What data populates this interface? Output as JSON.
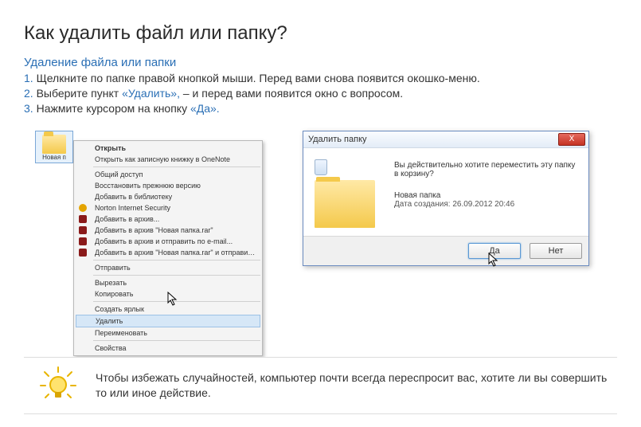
{
  "title": "Как удалить файл или папку?",
  "subtitle": "Удаление файла или папки",
  "steps": {
    "s1_num": "1.",
    "s1_a": "Щелкните по папке правой кнопкой мыши. Перед вами снова появится окошко-меню.",
    "s2_num": "2.",
    "s2_a": "Выберите пункт ",
    "s2_kw": "«Удалить»,",
    "s2_b": " – и перед вами появится окно с вопросом.",
    "s3_num": "3.",
    "s3_a": "Нажмите курсором на кнопку ",
    "s3_kw": "«Да»."
  },
  "folder_label": "Новая п",
  "context_menu": {
    "open": "Открыть",
    "onenote": "Открыть как записную книжку в OneNote",
    "share": "Общий доступ",
    "restore": "Восстановить прежнюю версию",
    "library": "Добавить в библиотеку",
    "norton": "Norton Internet Security",
    "addarch": "Добавить в архив...",
    "addrar": "Добавить в архив \"Новая папка.rar\"",
    "addemail": "Добавить в архив и отправить по e-mail...",
    "addraremail": "Добавить в архив \"Новая папка.rar\" и отправить по e-mail",
    "send": "Отправить",
    "cut": "Вырезать",
    "copy": "Копировать",
    "shortcut": "Создать ярлык",
    "delete": "Удалить",
    "rename": "Переименовать",
    "props": "Свойства"
  },
  "dialog": {
    "title": "Удалить папку",
    "question": "Вы действительно хотите переместить эту папку в корзину?",
    "name": "Новая папка",
    "date": "Дата создания: 26.09.2012 20:46",
    "yes": "Да",
    "no": "Нет",
    "close": "X"
  },
  "tip": "Чтобы избежать случайностей, компьютер почти всегда переспросит вас, хотите ли вы совершить то или иное действие."
}
